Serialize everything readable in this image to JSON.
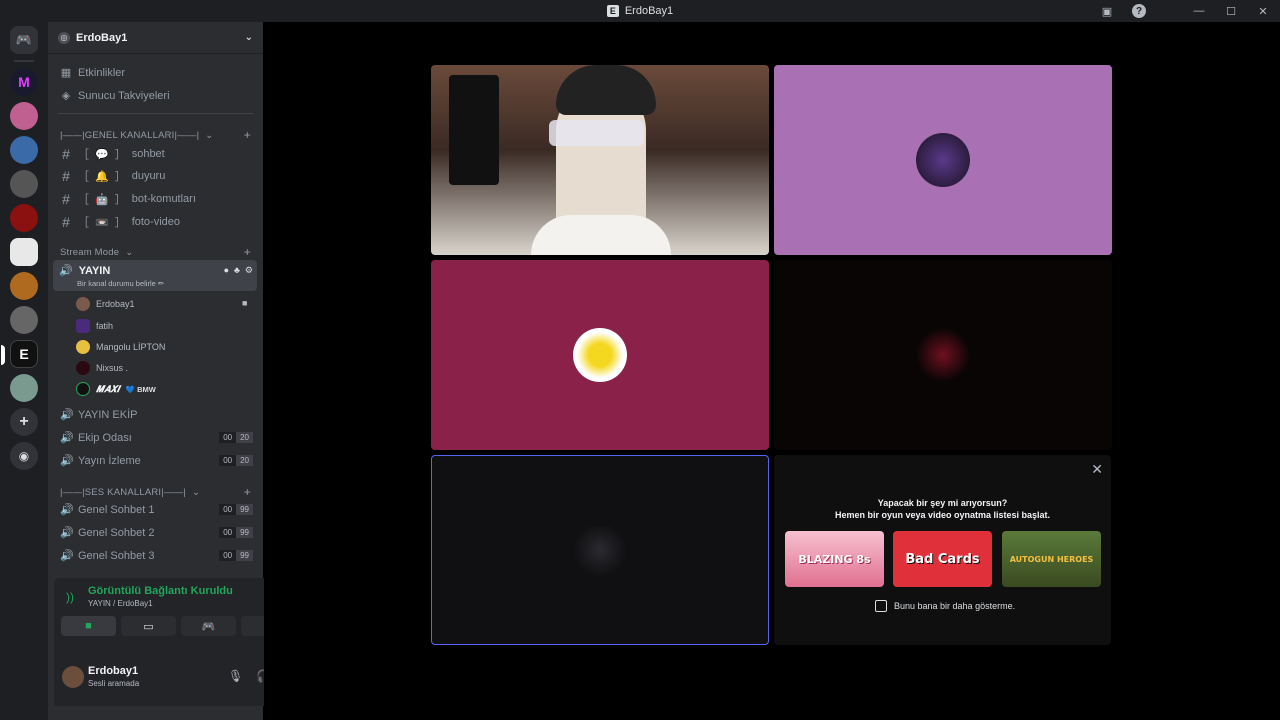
{
  "titlebar": {
    "title": "ErdoBay1"
  },
  "server": {
    "name": "ErdoBay1"
  },
  "nav": {
    "events": "Etkinlikler",
    "boosts": "Sunucu Takviyeleri"
  },
  "categories": {
    "general": "|——|GENEL KANALLARI|——|",
    "stream": "Stream Mode",
    "voice": "|——|SES KANALLARI|——|"
  },
  "text_channels": [
    {
      "name": "sohbet",
      "emoji": "💬"
    },
    {
      "name": "duyuru",
      "emoji": "🔔"
    },
    {
      "name": "bot-komutları",
      "emoji": "🤖"
    },
    {
      "name": "foto-video",
      "emoji": "📼"
    }
  ],
  "active_voice": {
    "name": "YAYIN",
    "status": "Bir kanal durumu belirle ✏"
  },
  "members": [
    "Erdobay1",
    "fatih",
    "Mangolu LİPTON",
    "Nixsus .",
    "𝑴𝑨𝑿𝑰"
  ],
  "member_tag": "💙 BMW",
  "voice_channels": [
    {
      "name": "YAYIN EKİP",
      "c1": "",
      "c2": ""
    },
    {
      "name": "Ekip Odası",
      "c1": "00",
      "c2": "20"
    },
    {
      "name": "Yayın İzleme",
      "c1": "00",
      "c2": "20"
    },
    {
      "name": "Genel Sohbet 1",
      "c1": "00",
      "c2": "99"
    },
    {
      "name": "Genel Sohbet 2",
      "c1": "00",
      "c2": "99"
    },
    {
      "name": "Genel Sohbet 3",
      "c1": "00",
      "c2": "99"
    }
  ],
  "connection": {
    "title": "Görüntülü Bağlantı Kuruldu",
    "sub": "YAYIN / ErdoBay1"
  },
  "user": {
    "name": "Erdobay1",
    "status": "Sesli aramada"
  },
  "promo": {
    "q1": "Yapacak bir şey mi arıyorsun?",
    "q2": "Hemen bir oyun veya video oynatma listesi başlat.",
    "checkbox": "Bunu bana bir daha gösterme.",
    "games": [
      "BLAZING 8s",
      "Bad Cards",
      "AUTOGUN HEROES"
    ]
  },
  "colors": {
    "accent_green": "#23a55a",
    "tile_purple": "#a970b4",
    "tile_maroon": "#8a2148",
    "focus_border": "#5865f2"
  }
}
